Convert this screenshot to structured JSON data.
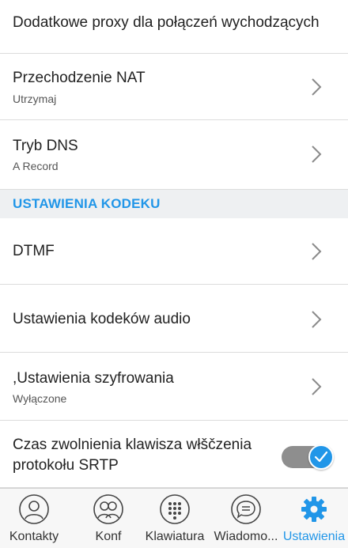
{
  "settings": {
    "outbound_proxy": {
      "title": "Dodatkowe proxy dla połączeń wychodzących"
    },
    "nat": {
      "title": "Przechodzenie NAT",
      "value": "Utrzymaj"
    },
    "dns": {
      "title": "Tryb DNS",
      "value": "A Record"
    },
    "codec_section": {
      "label": "USTAWIENIA KODEKU"
    },
    "dtmf": {
      "title": "DTMF"
    },
    "audio_codecs": {
      "title": "Ustawienia kodeków audio"
    },
    "encryption": {
      "title": ",Ustawienia szyfrowania",
      "value": "Wyłączone"
    },
    "srtp_key_release": {
      "title_line1": "Czas zwolnienia klawisza włščzenia",
      "title_line2": "protokołu SRTP",
      "enabled": true
    }
  },
  "tabbar": {
    "items": [
      {
        "label": "Kontakty",
        "icon": "contacts-icon",
        "active": false
      },
      {
        "label": "Konf",
        "icon": "conference-icon",
        "active": false
      },
      {
        "label": "Klawiatura",
        "icon": "dialpad-icon",
        "active": false
      },
      {
        "label": "Wiadomo...",
        "icon": "messages-icon",
        "active": false
      },
      {
        "label": "Ustawienia",
        "icon": "gear-icon",
        "active": true
      }
    ]
  },
  "colors": {
    "accent": "#2196e8",
    "toggle_track": "#8e8e8e",
    "section_bg": "#eef0f2",
    "chevron": "#8a8a8a"
  }
}
